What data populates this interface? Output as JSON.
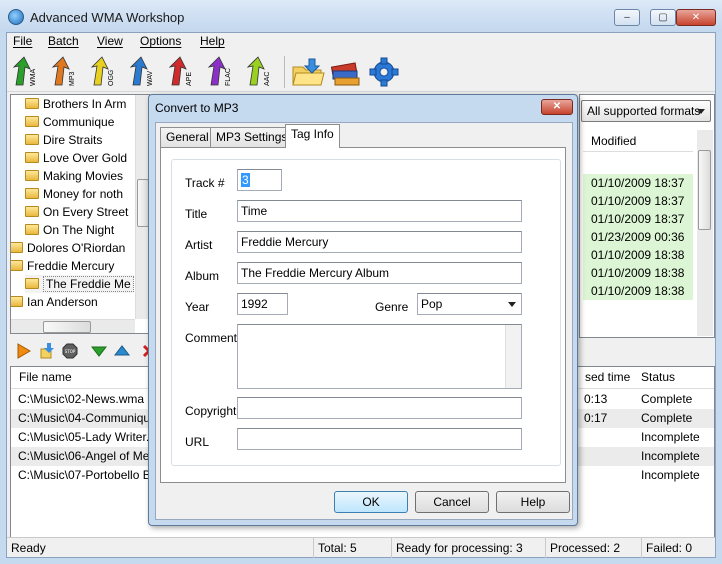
{
  "window": {
    "title": "Advanced WMA Workshop"
  },
  "caption_buttons": {
    "minimize": "–",
    "maximize": "▢",
    "close": "✕"
  },
  "menu": [
    "File",
    "Batch",
    "View",
    "Options",
    "Help"
  ],
  "toolbar": {
    "formats": [
      {
        "label": "WMA",
        "color": "#2aa02a"
      },
      {
        "label": "MP3",
        "color": "#e07820"
      },
      {
        "label": "OGG",
        "color": "#e8d020"
      },
      {
        "label": "WAV",
        "color": "#2a7ad0"
      },
      {
        "label": "APE",
        "color": "#d02a2a"
      },
      {
        "label": "FLAC",
        "color": "#8a30c8"
      },
      {
        "label": "AAC",
        "color": "#9ad020"
      }
    ],
    "extra_icons": [
      "open-folder-icon",
      "books-icon",
      "settings-gear-icon"
    ]
  },
  "tree": {
    "items": [
      {
        "label": "Brothers In Arm",
        "indent": 1
      },
      {
        "label": "Communique",
        "indent": 1
      },
      {
        "label": "Dire Straits",
        "indent": 1
      },
      {
        "label": "Love Over Gold",
        "indent": 1
      },
      {
        "label": "Making Movies",
        "indent": 1
      },
      {
        "label": "Money for noth",
        "indent": 1
      },
      {
        "label": "On Every Street",
        "indent": 1
      },
      {
        "label": "On The Night",
        "indent": 1
      },
      {
        "label": "Dolores O'Riordan",
        "indent": 0
      },
      {
        "label": "Freddie Mercury",
        "indent": 0
      },
      {
        "label": "The Freddie Me",
        "indent": 1,
        "selected": true
      },
      {
        "label": "Ian Anderson",
        "indent": 0
      }
    ]
  },
  "filter": {
    "selected": "All supported formats"
  },
  "files_list": {
    "modified_header": "Modified",
    "modified": [
      "01/10/2009 18:37",
      "01/10/2009 18:37",
      "01/10/2009 18:37",
      "01/23/2009 00:36",
      "01/10/2009 18:38",
      "01/10/2009 18:38",
      "01/10/2009 18:38"
    ]
  },
  "queue": {
    "headers": {
      "file_name": "File name",
      "elapsed": "sed time",
      "status": "Status"
    },
    "rows": [
      {
        "file": "C:\\Music\\02-News.wma",
        "elapsed": "0:13",
        "status": "Complete"
      },
      {
        "file": "C:\\Music\\04-Communiqu",
        "elapsed": "0:17",
        "status": "Complete"
      },
      {
        "file": "C:\\Music\\05-Lady Writer.",
        "elapsed": "",
        "status": "Incomplete"
      },
      {
        "file": "C:\\Music\\06-Angel of Me",
        "elapsed": "",
        "status": "Incomplete"
      },
      {
        "file": "C:\\Music\\07-Portobello B",
        "elapsed": "",
        "status": "Incomplete"
      }
    ]
  },
  "statusbar": {
    "ready": "Ready",
    "total": "Total: 5",
    "ready_for_processing": "Ready for processing: 3",
    "processed": "Processed: 2",
    "failed": "Failed: 0"
  },
  "dialog": {
    "title": "Convert to MP3",
    "tabs": [
      "General",
      "MP3 Settings",
      "Tag Info"
    ],
    "active_tab": "Tag Info",
    "fields": {
      "track_label": "Track #",
      "track_value": "3",
      "title_label": "Title",
      "title_value": "Time",
      "artist_label": "Artist",
      "artist_value": "Freddie Mercury",
      "album_label": "Album",
      "album_value": "The Freddie Mercury Album",
      "year_label": "Year",
      "year_value": "1992",
      "genre_label": "Genre",
      "genre_value": "Pop",
      "comment_label": "Comment",
      "comment_value": "",
      "copyright_label": "Copyright",
      "copyright_value": "",
      "url_label": "URL",
      "url_value": ""
    },
    "buttons": {
      "ok": "OK",
      "cancel": "Cancel",
      "help": "Help"
    }
  }
}
